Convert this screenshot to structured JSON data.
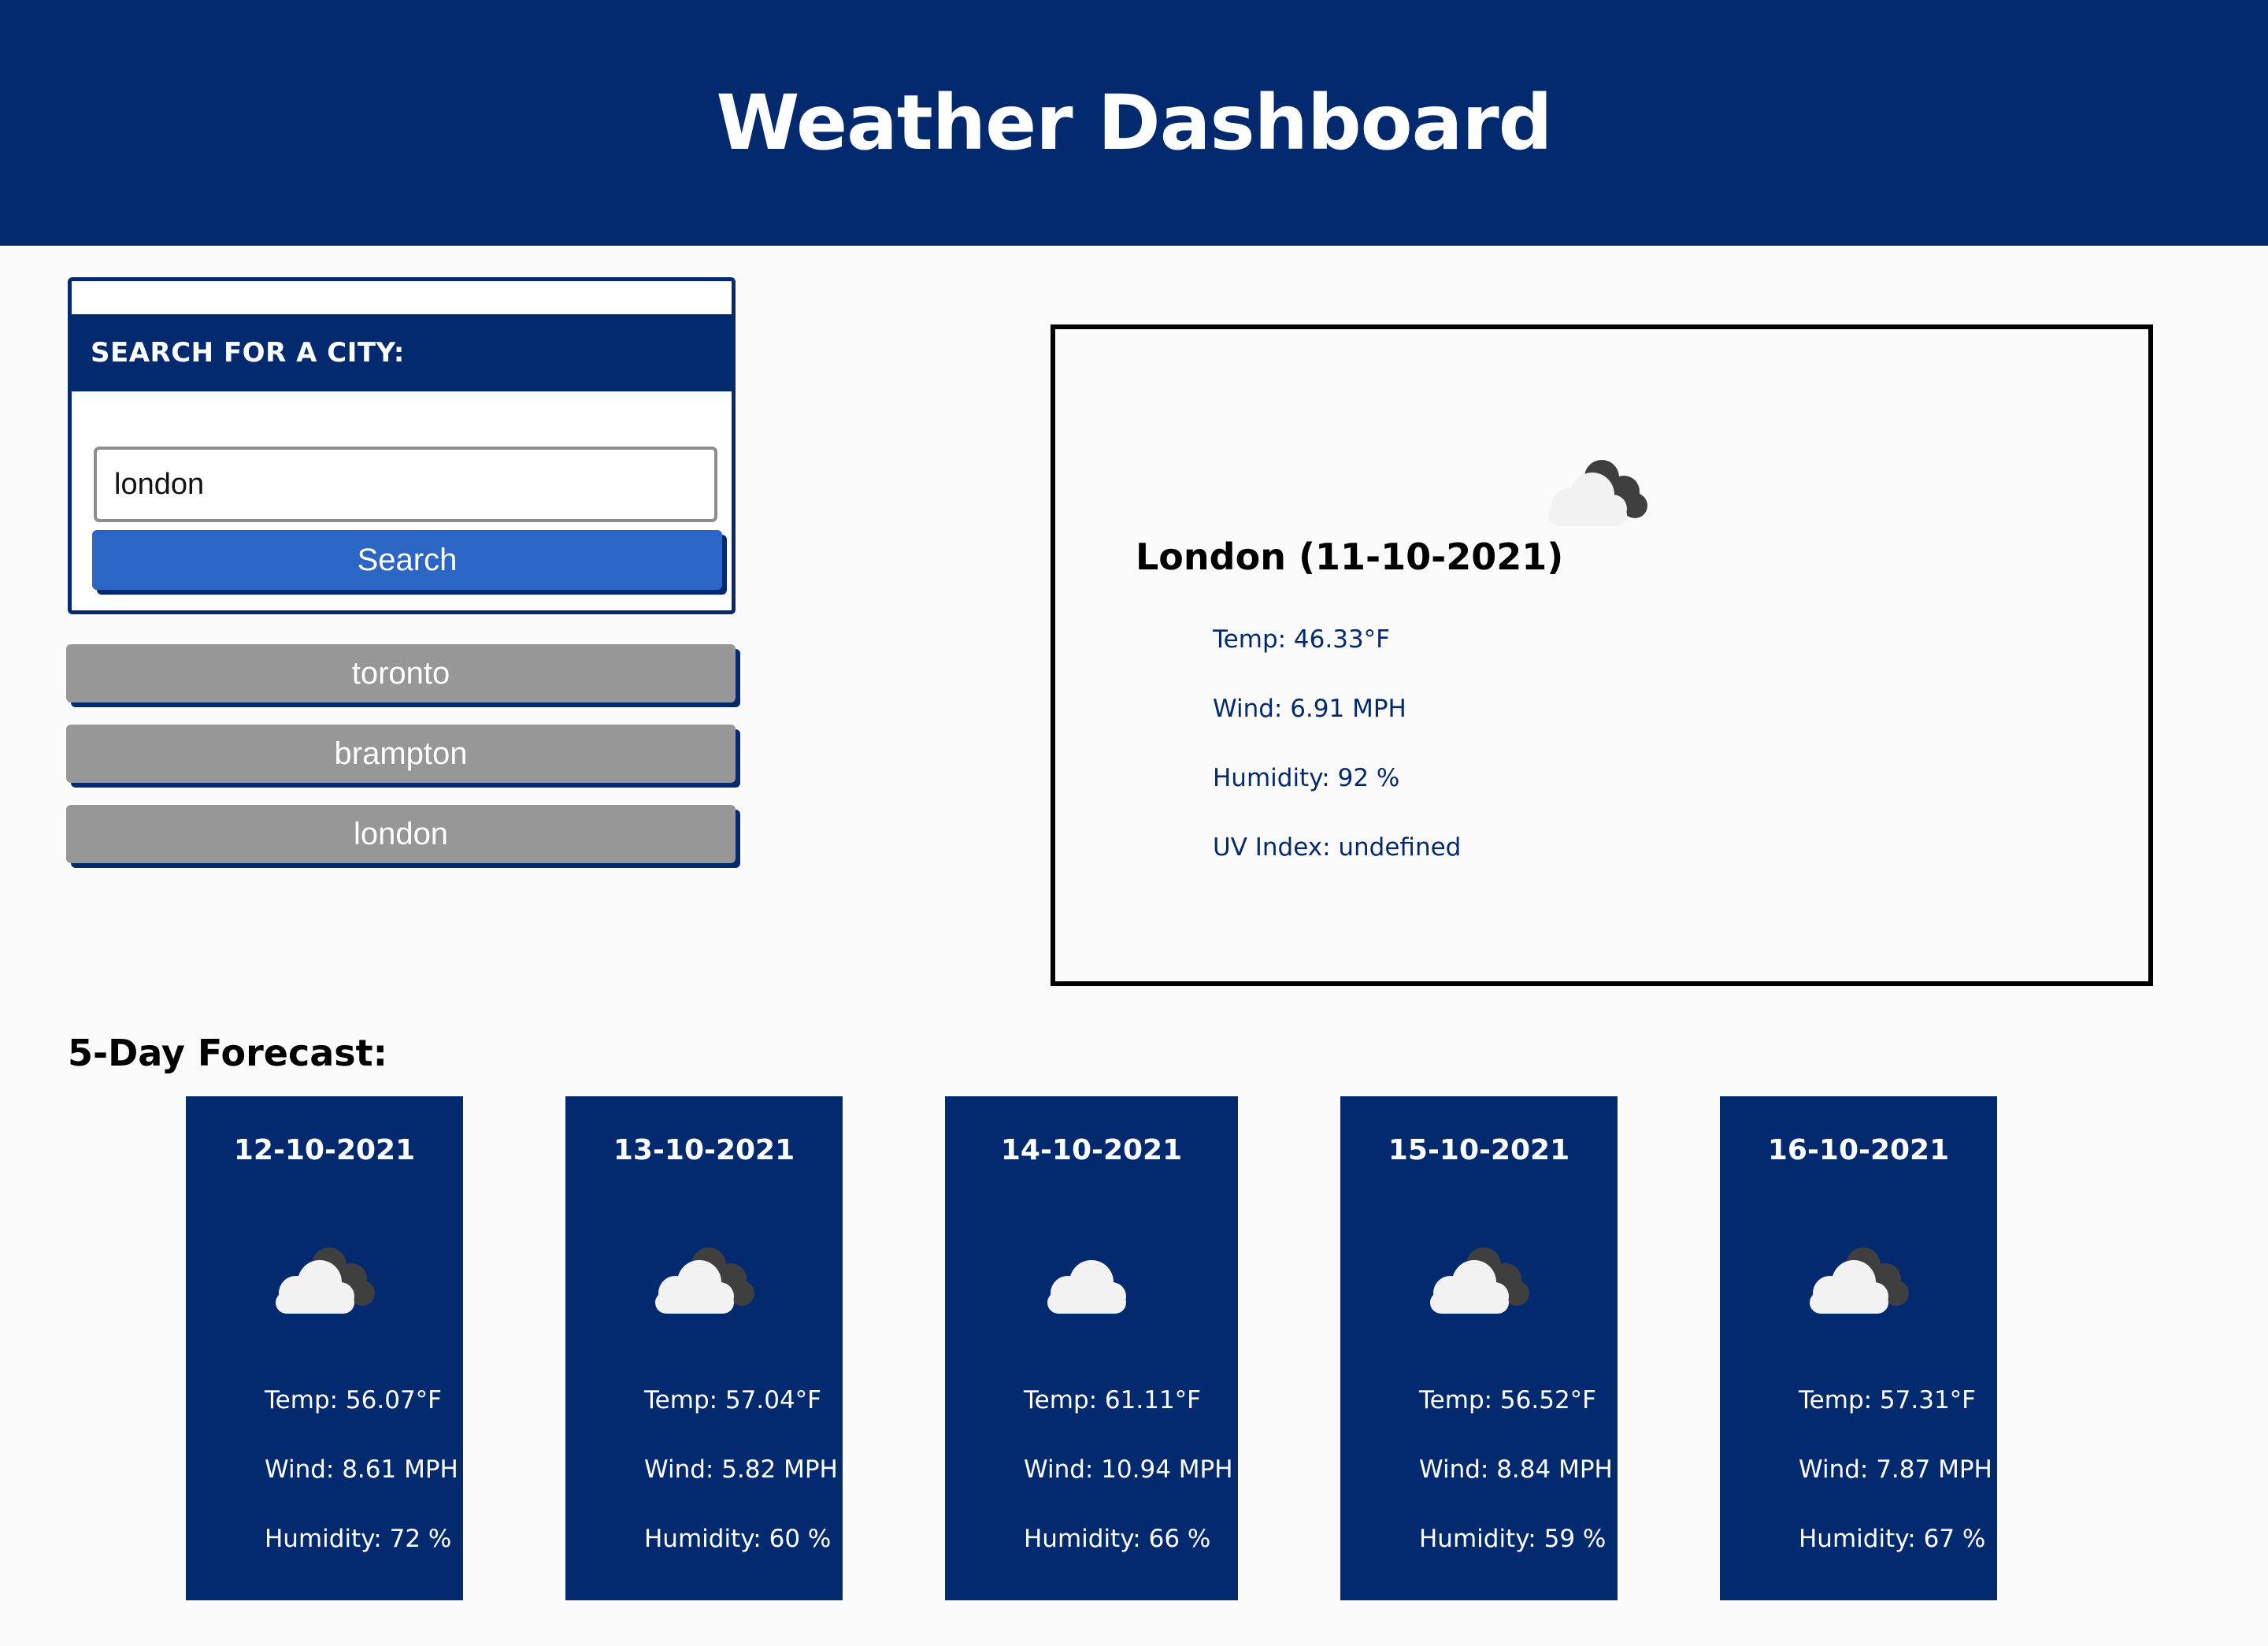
{
  "header": {
    "title": "Weather Dashboard"
  },
  "search": {
    "heading": "SEARCH FOR A CITY:",
    "input_value": "london",
    "button_label": "Search"
  },
  "history": [
    {
      "label": "toronto"
    },
    {
      "label": "brampton"
    },
    {
      "label": "london"
    }
  ],
  "current": {
    "title": "London (11-10-2021)",
    "icon": "partly-cloudy-icon",
    "temp": "Temp: 46.33°F",
    "wind": "Wind: 6.91 MPH",
    "humidity": "Humidity: 92 %",
    "uv": "UV Index: undefined"
  },
  "forecast": {
    "title": "5-Day Forecast:",
    "days": [
      {
        "date": "12-10-2021",
        "icon": "broken-clouds-icon",
        "temp": "Temp: 56.07°F",
        "wind": "Wind: 8.61 MPH",
        "humidity": "Humidity: 72 %"
      },
      {
        "date": "13-10-2021",
        "icon": "broken-clouds-icon",
        "temp": "Temp: 57.04°F",
        "wind": "Wind: 5.82 MPH",
        "humidity": "Humidity: 60 %"
      },
      {
        "date": "14-10-2021",
        "icon": "cloud-icon",
        "temp": "Temp: 61.11°F",
        "wind": "Wind: 10.94 MPH",
        "humidity": "Humidity: 66 %"
      },
      {
        "date": "15-10-2021",
        "icon": "broken-clouds-icon",
        "temp": "Temp: 56.52°F",
        "wind": "Wind: 8.84 MPH",
        "humidity": "Humidity: 59 %"
      },
      {
        "date": "16-10-2021",
        "icon": "broken-clouds-icon",
        "temp": "Temp: 57.31°F",
        "wind": "Wind: 7.87 MPH",
        "humidity": "Humidity: 67 %"
      }
    ]
  },
  "colors": {
    "primary": "#032a6e",
    "button_blue": "#2c66c4",
    "history_gray": "#979797"
  }
}
